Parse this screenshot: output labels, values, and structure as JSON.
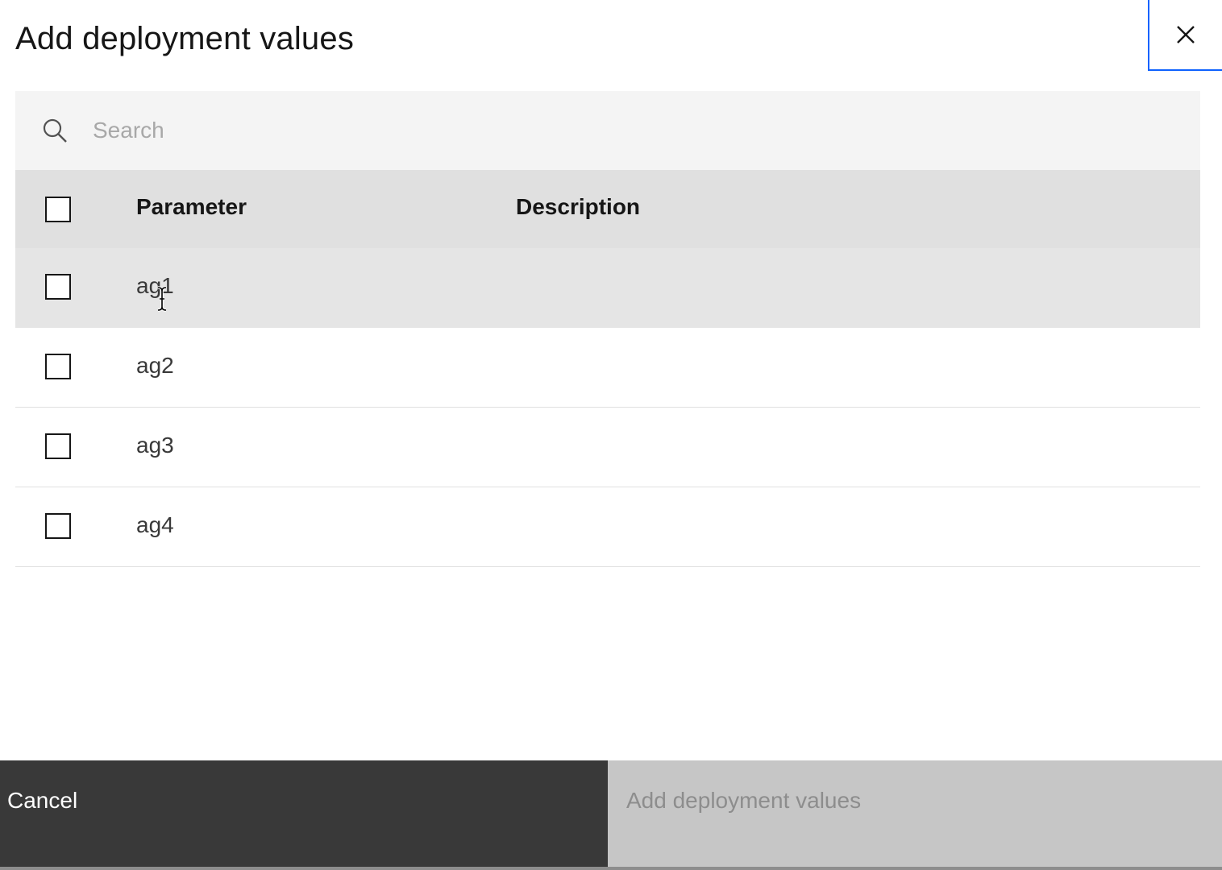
{
  "modal": {
    "title": "Add deployment values",
    "close_label": "Close"
  },
  "search": {
    "placeholder": "Search",
    "value": ""
  },
  "table": {
    "headers": {
      "parameter": "Parameter",
      "description": "Description"
    },
    "rows": [
      {
        "parameter": "ag1",
        "description": ""
      },
      {
        "parameter": "ag2",
        "description": ""
      },
      {
        "parameter": "ag3",
        "description": ""
      },
      {
        "parameter": "ag4",
        "description": ""
      }
    ]
  },
  "footer": {
    "cancel_label": "Cancel",
    "primary_label": "Add deployment values"
  },
  "colors": {
    "focus": "#0f62fe",
    "header_bg": "#e0e0e0",
    "search_bg": "#f4f4f4",
    "cancel_bg": "#393939",
    "disabled_bg": "#c6c6c6"
  }
}
